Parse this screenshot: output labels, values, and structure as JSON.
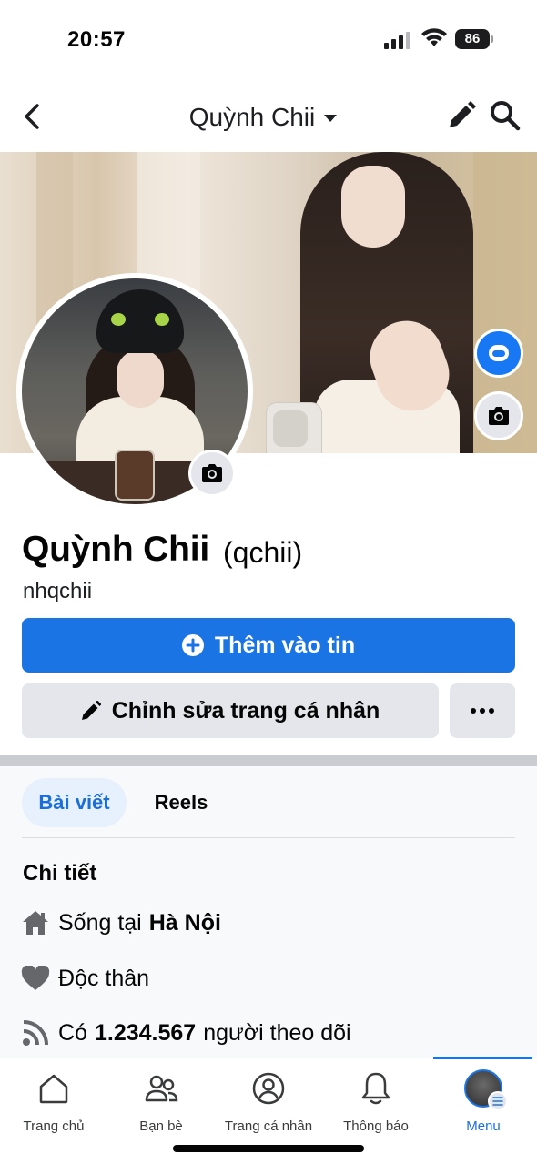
{
  "status_bar": {
    "time": "20:57",
    "battery": "86"
  },
  "nav": {
    "title": "Quỳnh Chii"
  },
  "profile": {
    "name": "Quỳnh Chii",
    "alternate_name": "(qchii)",
    "username": "nhqchii"
  },
  "actions": {
    "add_story": "Thêm vào tin",
    "edit_profile": "Chỉnh sửa trang cá nhân"
  },
  "tabs": [
    {
      "label": "Bài viết",
      "active": true
    },
    {
      "label": "Reels",
      "active": false
    }
  ],
  "details": {
    "title": "Chi tiết",
    "lives_prefix": "Sống tại",
    "lives_value": "Hà Nội",
    "relationship": "Độc thân",
    "followers_prefix": "Có",
    "followers_value": "1.234.567",
    "followers_suffix": "người theo dõi"
  },
  "bottom_nav": [
    {
      "label": "Trang chủ",
      "icon": "home-icon"
    },
    {
      "label": "Bạn bè",
      "icon": "friends-icon"
    },
    {
      "label": "Trang cá nhân",
      "icon": "profile-icon"
    },
    {
      "label": "Thông báo",
      "icon": "bell-icon"
    },
    {
      "label": "Menu",
      "icon": "menu-avatar",
      "active": true
    }
  ],
  "colors": {
    "accent": "#1b74e4",
    "secondary_button": "#e4e6eb",
    "active_tab_bg": "#e7f0fd"
  }
}
